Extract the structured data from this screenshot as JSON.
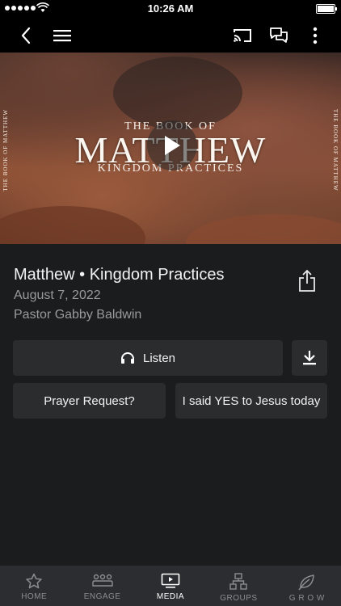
{
  "status_bar": {
    "time": "10:26 AM"
  },
  "hero": {
    "side_text": "THE BOOK OF MATTHEW",
    "title_line1": "THE BOOK OF",
    "title_main": "MATTHEW",
    "title_line3": "KINGDOM PRACTICES"
  },
  "media": {
    "title": "Matthew • Kingdom Practices",
    "date": "August 7, 2022",
    "speaker": "Pastor Gabby Baldwin"
  },
  "actions": {
    "listen_label": "Listen",
    "prayer_label": "Prayer Request?",
    "yes_label": "I said YES to Jesus today"
  },
  "tabs": [
    {
      "label": "HOME",
      "icon": "star-icon"
    },
    {
      "label": "ENGAGE",
      "icon": "people-icon"
    },
    {
      "label": "MEDIA",
      "icon": "video-icon",
      "active": true
    },
    {
      "label": "GROUPS",
      "icon": "groups-icon"
    },
    {
      "label": "G R O W",
      "icon": "leaf-icon"
    }
  ],
  "colors": {
    "background": "#1b1c1e",
    "button": "#2b2c2e",
    "tabbar": "#2c2d30",
    "inactive": "#8d8d8f"
  }
}
